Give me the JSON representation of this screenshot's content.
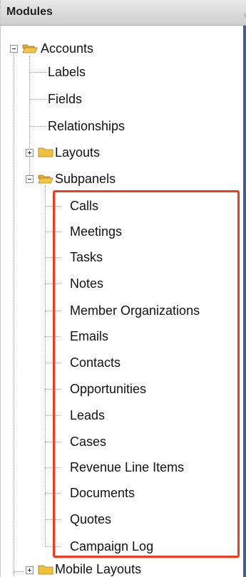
{
  "panel": {
    "title": "Modules",
    "collapse_glyph": "‹"
  },
  "tree": {
    "accounts": {
      "label": "Accounts",
      "state": "expanded",
      "icon": "folder-open-icon"
    },
    "children": [
      {
        "label": "Labels"
      },
      {
        "label": "Fields"
      },
      {
        "label": "Relationships"
      }
    ],
    "layouts": {
      "label": "Layouts",
      "state": "collapsed",
      "icon": "folder-closed-icon"
    },
    "subpanels": {
      "label": "Subpanels",
      "state": "expanded",
      "icon": "folder-open-icon",
      "items": [
        {
          "label": "Calls"
        },
        {
          "label": "Meetings"
        },
        {
          "label": "Tasks"
        },
        {
          "label": "Notes"
        },
        {
          "label": "Member Organizations"
        },
        {
          "label": "Emails"
        },
        {
          "label": "Contacts"
        },
        {
          "label": "Opportunities"
        },
        {
          "label": "Leads"
        },
        {
          "label": "Cases"
        },
        {
          "label": "Revenue Line Items"
        },
        {
          "label": "Documents"
        },
        {
          "label": "Quotes"
        },
        {
          "label": "Campaign Log"
        }
      ]
    },
    "mobile_layouts": {
      "label": "Mobile Layouts",
      "state": "collapsed",
      "icon": "folder-closed-icon"
    }
  },
  "colors": {
    "highlight": "#f23a20",
    "scrollbar": "#3a5ea7",
    "folder_fill": "#f0c23a"
  }
}
